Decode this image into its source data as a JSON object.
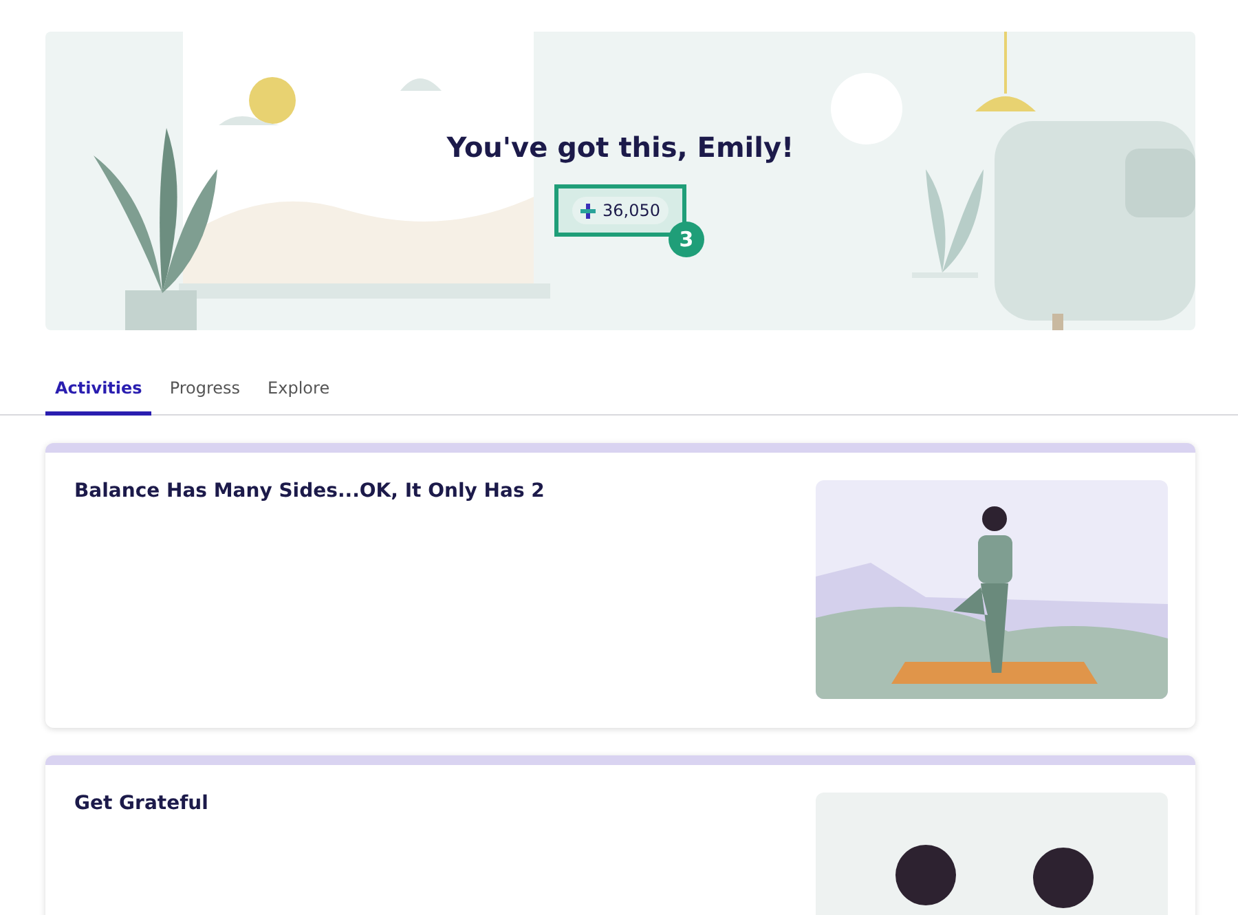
{
  "hero": {
    "title": "You've got this, Emily!",
    "points": "36,050",
    "callout": "3"
  },
  "tabs": [
    {
      "label": "Activities",
      "selected": true
    },
    {
      "label": "Progress",
      "selected": false
    },
    {
      "label": "Explore",
      "selected": false
    }
  ],
  "cards": [
    {
      "title": "Balance Has Many Sides...OK, It Only Has 2",
      "kind": "yoga"
    },
    {
      "title": "Get Grateful",
      "kind": "people"
    }
  ]
}
